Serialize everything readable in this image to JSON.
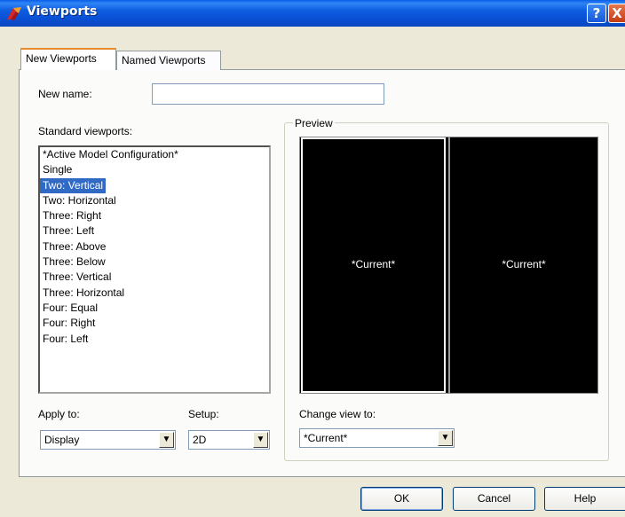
{
  "window": {
    "title": "Viewports"
  },
  "titlebar_buttons": {
    "help": "?",
    "close": "X"
  },
  "tabs": [
    {
      "label": "New Viewports",
      "active": true
    },
    {
      "label": "Named Viewports",
      "active": false
    }
  ],
  "new_name": {
    "label": "New name:",
    "value": ""
  },
  "standard_viewports": {
    "label": "Standard viewports:",
    "items": [
      "*Active Model Configuration*",
      "Single",
      "Two:  Vertical",
      "Two:  Horizontal",
      "Three: Right",
      "Three: Left",
      "Three: Above",
      "Three: Below",
      "Three: Vertical",
      "Three: Horizontal",
      "Four:  Equal",
      "Four:  Right",
      "Four:  Left"
    ],
    "selected_index": 2
  },
  "preview": {
    "title": "Preview",
    "left_label": "*Current*",
    "right_label": "*Current*"
  },
  "apply_to": {
    "label": "Apply to:",
    "value": "Display"
  },
  "setup": {
    "label": "Setup:",
    "value": "2D"
  },
  "change_view": {
    "label": "Change view to:",
    "value": "*Current*"
  },
  "buttons": {
    "ok": "OK",
    "cancel": "Cancel",
    "help": "Help"
  },
  "icons": {
    "app": "autocad-icon",
    "dropdown": "chevron-down-icon"
  },
  "colors": {
    "titlebar": "#0a50d4",
    "selection": "#316ac5",
    "tab_highlight": "#e68b2c"
  }
}
